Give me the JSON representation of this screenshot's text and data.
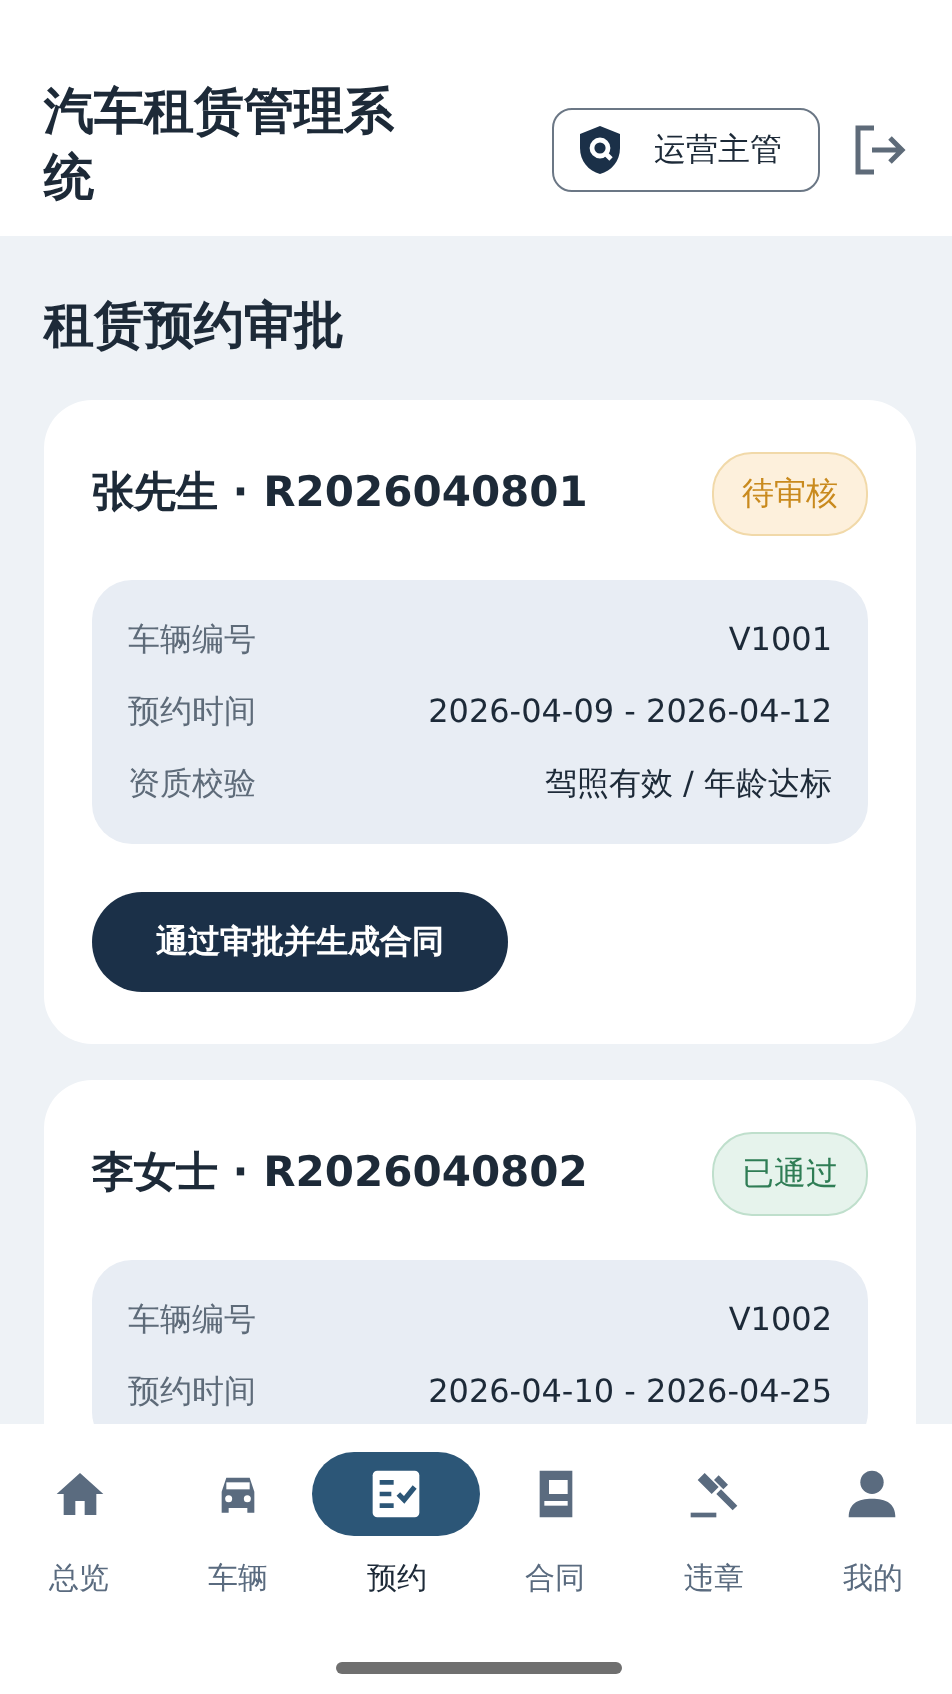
{
  "app_title": "汽车租赁管理系统",
  "role_button": {
    "label": "运营主管"
  },
  "section_title": "租赁预约审批",
  "reservations": [
    {
      "title": "张先生 · R2026040801",
      "status": {
        "label": "待审核",
        "kind": "pending"
      },
      "fields": [
        {
          "label": "车辆编号",
          "value": "V1001"
        },
        {
          "label": "预约时间",
          "value": "2026-04-09 - 2026-04-12"
        },
        {
          "label": "资质校验",
          "value": "驾照有效 / 年龄达标"
        }
      ],
      "action": "通过审批并生成合同"
    },
    {
      "title": "李女士 · R2026040802",
      "status": {
        "label": "已通过",
        "kind": "approved"
      },
      "fields": [
        {
          "label": "车辆编号",
          "value": "V1002"
        },
        {
          "label": "预约时间",
          "value": "2026-04-10 - 2026-04-25"
        }
      ]
    }
  ],
  "tabs": [
    {
      "label": "总览",
      "selected": false
    },
    {
      "label": "车辆",
      "selected": false
    },
    {
      "label": "预约",
      "selected": true
    },
    {
      "label": "合同",
      "selected": false
    },
    {
      "label": "违章",
      "selected": false
    },
    {
      "label": "我的",
      "selected": false
    }
  ]
}
